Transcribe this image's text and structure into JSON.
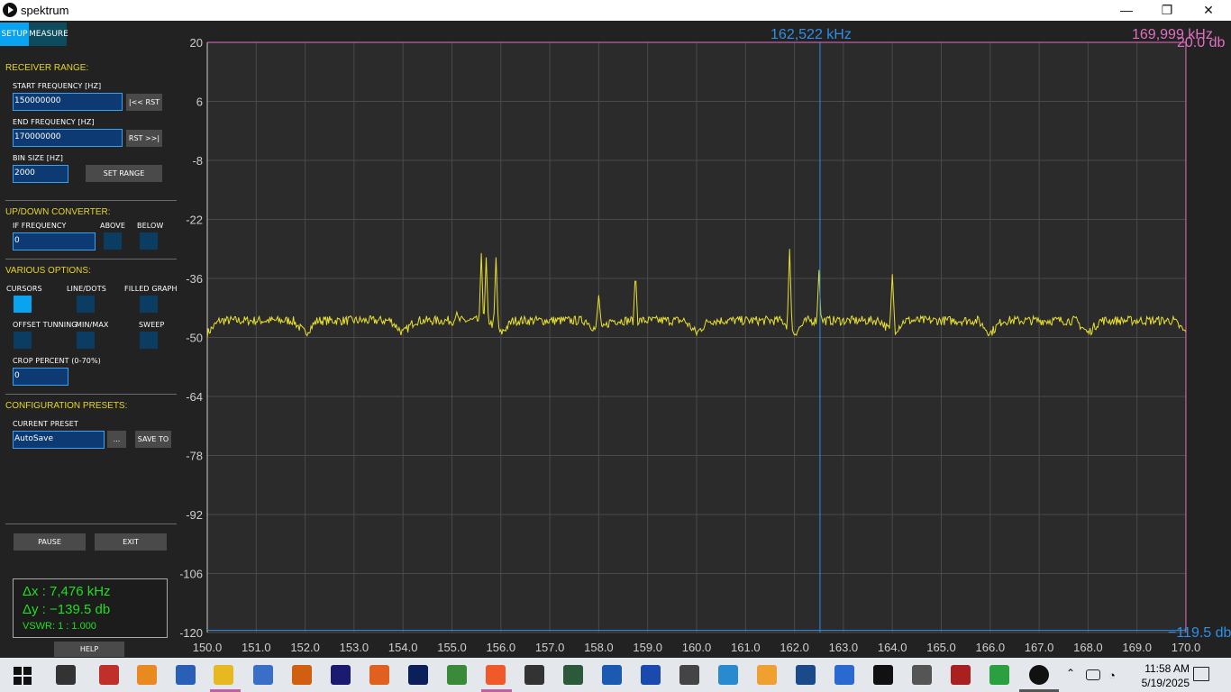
{
  "window": {
    "title": "spektrum",
    "minimize": "—",
    "restore": "❐",
    "close": "✕"
  },
  "tabs": {
    "setup": "SETUP",
    "measure": "MEASURE"
  },
  "receiver_range": {
    "heading": "RECEIVER RANGE:",
    "start_label": "START FREQUENCY [HZ]",
    "start_value": "150000000",
    "start_button": "|<< RST",
    "end_label": "END FREQUENCY [HZ]",
    "end_value": "170000000",
    "end_button": "RST >>|",
    "bin_label": "BIN SIZE [HZ]",
    "bin_value": "2000",
    "set_range": "SET RANGE"
  },
  "converter": {
    "heading": "UP/DOWN CONVERTER:",
    "if_label": "IF FREQUENCY",
    "if_value": "0",
    "above": "ABOVE",
    "below": "BELOW"
  },
  "options": {
    "heading": "VARIOUS OPTIONS:",
    "cursors": "CURSORS",
    "line_dots": "LINE/DOTS",
    "filled_graph": "FILLED GRAPH",
    "offset_tuning": "OFFSET TUNNING",
    "min_max": "MIN/MAX",
    "sweep": "SWEEP",
    "crop_label": "CROP PERCENT (0-70%)",
    "crop_value": "0"
  },
  "presets": {
    "heading": "CONFIGURATION PRESETS:",
    "current_label": "CURRENT PRESET",
    "current_value": "AutoSave",
    "browse": "...",
    "save_to": "SAVE TO"
  },
  "controls": {
    "pause": "PAUSE",
    "exit": "EXIT",
    "help": "HELP"
  },
  "measurement": {
    "dx": "Δx : 7,476 kHz",
    "dy": "Δy : −139.5 db",
    "vswr": "VSWR: 1 : 1.000"
  },
  "cursor_readouts": {
    "cursor1_freq": "162,522 kHz",
    "cursor2_freq": "169,999 kHz",
    "cursor2_level": "20.0 db",
    "cursor1_level": "−119.5 db"
  },
  "colors": {
    "trace": "#e8e030",
    "cursor1": "#2f8fe8",
    "cursor2": "#e070c0",
    "grid": "#4a4a4a",
    "accent": "#0aa3f0",
    "heading": "#e6d628"
  },
  "chart_data": {
    "type": "line",
    "xlim": [
      150.0,
      170.0
    ],
    "ylim": [
      -120,
      20
    ],
    "x_ticks": [
      "150.0",
      "151.0",
      "152.0",
      "153.0",
      "154.0",
      "155.0",
      "156.0",
      "157.0",
      "158.0",
      "159.0",
      "160.0",
      "161.0",
      "162.0",
      "163.0",
      "164.0",
      "165.0",
      "166.0",
      "167.0",
      "168.0",
      "169.0",
      "170.0"
    ],
    "y_ticks": [
      "20",
      "6",
      "-8",
      "-22",
      "-36",
      "-50",
      "-64",
      "-78",
      "-92",
      "-106",
      "-120"
    ],
    "grid": true,
    "noise_floor": -46,
    "peaks": [
      {
        "x": 155.1,
        "y": -44
      },
      {
        "x": 155.6,
        "y": -30
      },
      {
        "x": 155.7,
        "y": -31
      },
      {
        "x": 155.9,
        "y": -31
      },
      {
        "x": 158.0,
        "y": -40
      },
      {
        "x": 158.75,
        "y": -34
      },
      {
        "x": 161.9,
        "y": -29
      },
      {
        "x": 162.5,
        "y": -34
      },
      {
        "x": 164.0,
        "y": -35
      }
    ],
    "dips": [
      150.0,
      152.0,
      154.0,
      156.0,
      158.0,
      160.0,
      162.0,
      164.0,
      166.0,
      168.0,
      170.0
    ],
    "cursor1_x": 162.522,
    "cursor2_x": 169.999,
    "cursor2_y": 20.0,
    "cursor1_y": -119.5
  },
  "taskbar": {
    "icons": [
      "windows-start-icon",
      "task-view-icon",
      "app-red-icon",
      "nt-icon",
      "powershell-icon",
      "file-explorer-icon",
      "network-icon",
      "paint-icon",
      "audition-icon",
      "app-orange-icon",
      "photoshop-icon",
      "notepad-icon",
      "brave-icon",
      "obs-icon",
      "terminal-icon",
      "wave-icon",
      "wave2-icon",
      "feather-icon",
      "satellite-icon",
      "orange-app-icon",
      "globe-icon",
      "shield-icon",
      "wr-icon",
      "wand-icon",
      "rox-icon",
      "earth-icon",
      "spektrum-icon"
    ],
    "time": "11:58 AM",
    "date": "5/19/2025"
  }
}
